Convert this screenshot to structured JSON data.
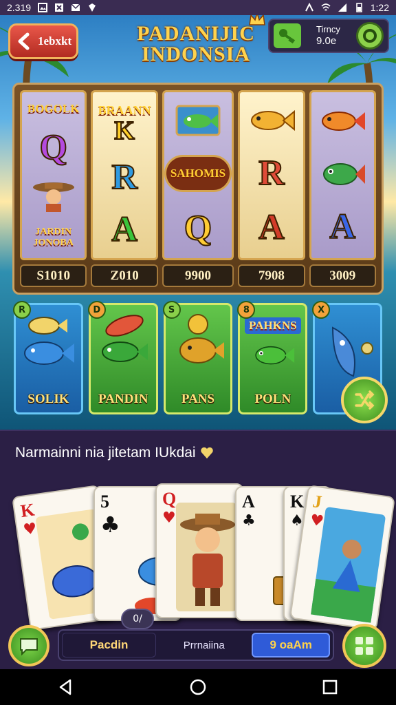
{
  "status_bar": {
    "left_text": "2.319",
    "time": "1:22"
  },
  "header": {
    "back_label": "1ebxkt",
    "title_line1": "PADANIJIC",
    "title_line2": "INDONSIA",
    "wallet_label": "Tirncy",
    "wallet_amount": "9.0e"
  },
  "reels": [
    {
      "top": "BOGOLK",
      "mid": "Q",
      "bottom_art": "cowboy",
      "bottom_text": "JARDIN\nJONOBA",
      "value": "S1010",
      "colors": [
        "#b44adf",
        "#e24d7a"
      ]
    },
    {
      "top": "BRAANN",
      "top_letter": "K",
      "mid": "R",
      "bottom": "A",
      "value": "Z010",
      "colors": [
        "#ffcf2a",
        "#2e9ae2",
        "#3ac43b"
      ]
    },
    {
      "top_art": "fish-frame",
      "mid_text": "SAHOMIS",
      "bottom": "Q",
      "value": "9900",
      "colors": [
        "#ffcc33"
      ]
    },
    {
      "top_art": "goldfish",
      "mid": "R",
      "bottom": "A",
      "value": "7908",
      "colors": [
        "#e04b38",
        "#d23b28"
      ]
    },
    {
      "top_art": "redfish",
      "mid_art": "greenfish",
      "bottom": "A",
      "value": "3009",
      "colors": [
        "#3a66e6"
      ]
    }
  ],
  "fish_cards": [
    {
      "badge": "R",
      "label": "SOLIK",
      "theme": "blue"
    },
    {
      "badge": "D",
      "label": "PANDIN",
      "theme": "green"
    },
    {
      "badge": "S",
      "label": "PANS",
      "theme": "green"
    },
    {
      "badge": "8",
      "ribbon": "PAHKNS",
      "label": "POLN",
      "theme": "green"
    },
    {
      "badge": "X",
      "label": "",
      "theme": "blue"
    }
  ],
  "panel": {
    "title": "Narmainni nia jitetam IUkdai",
    "cards_badge": "0/",
    "cards": [
      {
        "rank": "K",
        "suit": "♥",
        "color": "red"
      },
      {
        "rank": "5",
        "suit": "♣",
        "color": "blk"
      },
      {
        "rank": "Q",
        "suit": "♥",
        "color": "red"
      },
      {
        "rank": "A",
        "suit": "♣",
        "color": "blk"
      },
      {
        "rank": "K",
        "suit": "♠",
        "color": "blk"
      },
      {
        "rank": "J",
        "suit": "♥",
        "color": "red"
      }
    ],
    "tabs": [
      "Pacdin",
      "Prrnaiina",
      "9 oaAm"
    ]
  }
}
